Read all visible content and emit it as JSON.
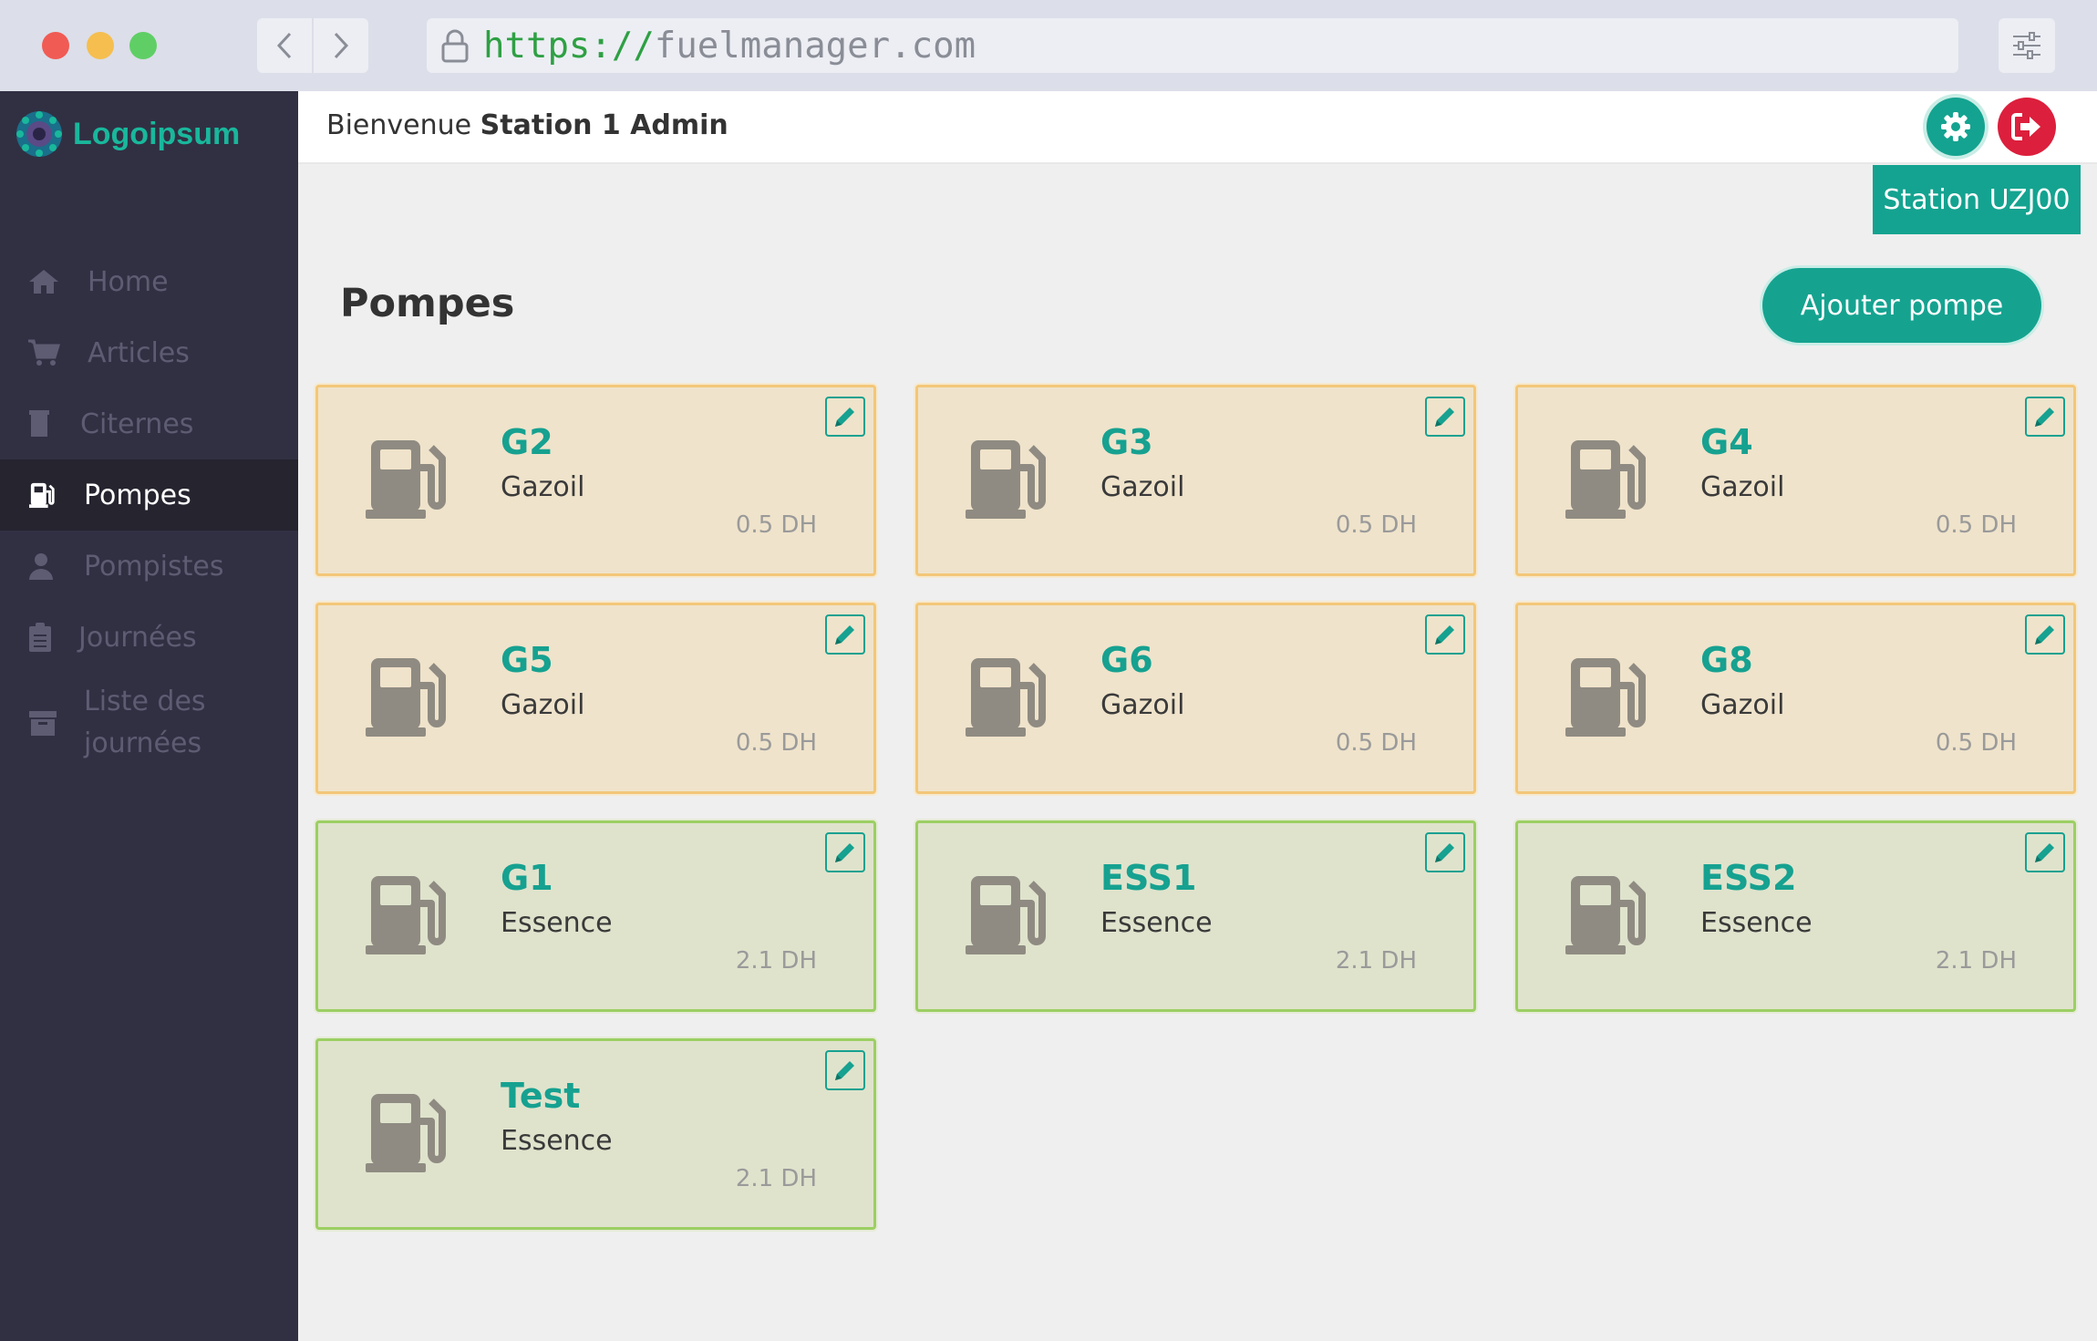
{
  "browser": {
    "url_scheme": "https://",
    "url_host": "fuelmanager.com"
  },
  "brand": {
    "name": "Logoipsum",
    "color": "#19b79c"
  },
  "sidebar": {
    "items": [
      {
        "label": "Home",
        "icon": "home-icon",
        "active": false
      },
      {
        "label": "Articles",
        "icon": "cart-icon",
        "active": false
      },
      {
        "label": "Citernes",
        "icon": "tank-icon",
        "active": false
      },
      {
        "label": "Pompes",
        "icon": "gas-pump-icon",
        "active": true
      },
      {
        "label": "Pompistes",
        "icon": "user-icon",
        "active": false
      },
      {
        "label": "Journées",
        "icon": "clipboard-icon",
        "active": false
      },
      {
        "label": "Liste des journées",
        "icon": "archive-icon",
        "active": false
      }
    ]
  },
  "header": {
    "welcome_prefix": "Bienvenue",
    "user_name": "Station 1 Admin",
    "settings_icon": "gear-icon",
    "logout_icon": "logout-icon"
  },
  "main": {
    "station_badge": "Station UZJ00",
    "title": "Pompes",
    "add_button": "Ajouter pompe",
    "pumps": [
      {
        "name": "G2",
        "type": "Gazoil",
        "price": "0.5 DH"
      },
      {
        "name": "G3",
        "type": "Gazoil",
        "price": "0.5 DH"
      },
      {
        "name": "G4",
        "type": "Gazoil",
        "price": "0.5 DH"
      },
      {
        "name": "G5",
        "type": "Gazoil",
        "price": "0.5 DH"
      },
      {
        "name": "G6",
        "type": "Gazoil",
        "price": "0.5 DH"
      },
      {
        "name": "G8",
        "type": "Gazoil",
        "price": "0.5 DH"
      },
      {
        "name": "G1",
        "type": "Essence",
        "price": "2.1 DH"
      },
      {
        "name": "ESS1",
        "type": "Essence",
        "price": "2.1 DH"
      },
      {
        "name": "ESS2",
        "type": "Essence",
        "price": "2.1 DH"
      },
      {
        "name": "Test",
        "type": "Essence",
        "price": "2.1 DH"
      }
    ]
  },
  "colors": {
    "accent": "#14a390",
    "danger": "#dc1f3c",
    "gazoil_bg": "#efe3cb",
    "essence_bg": "#dfe3cc"
  }
}
